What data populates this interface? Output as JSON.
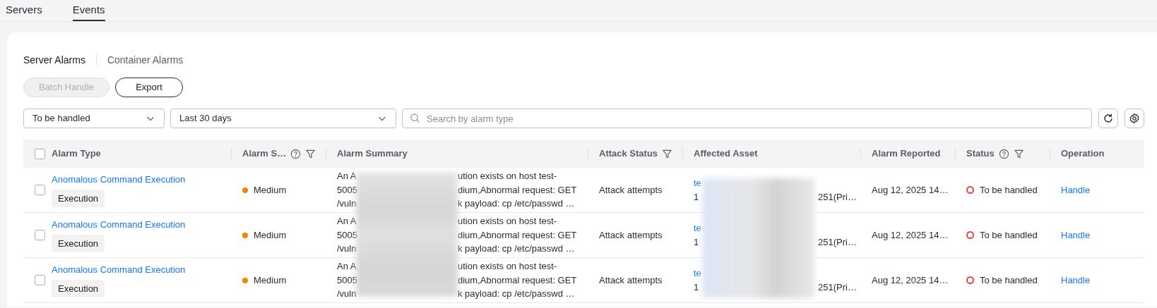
{
  "top_tabs": [
    {
      "label": "Servers",
      "selected": false
    },
    {
      "label": "Events",
      "selected": true
    }
  ],
  "alarm_tabs": [
    {
      "label": "Server Alarms",
      "selected": true
    },
    {
      "label": "Container Alarms",
      "selected": false
    }
  ],
  "actions": [
    {
      "label": "Batch Handle",
      "disabled": true
    },
    {
      "label": "Export",
      "disabled": false
    }
  ],
  "filters": {
    "status": "To be handled",
    "period": "Last 30 days",
    "search": {
      "placeholder": "Search by alarm type"
    }
  },
  "table": {
    "columns": [
      {
        "label": "Alarm Type",
        "help": false,
        "filter": false
      },
      {
        "label": "Alarm S…",
        "help": true,
        "filter": true
      },
      {
        "label": "Alarm Summary",
        "help": false,
        "filter": false
      },
      {
        "label": "Attack Status",
        "help": false,
        "filter": true
      },
      {
        "label": "Affected Asset",
        "help": false,
        "filter": false
      },
      {
        "label": "Alarm Reported",
        "help": false,
        "filter": false
      },
      {
        "label": "Status",
        "help": true,
        "filter": true
      },
      {
        "label": "Operation",
        "help": false,
        "filter": false
      }
    ],
    "all_selected": false,
    "rows": [
      {
        "selected": false,
        "alarm_type": "Anomalous Command Execution",
        "tag": "Execution",
        "severity": {
          "label": "Medium",
          "color": "#f5820b"
        },
        "summary": [
          {
            "before": "An A",
            "after": "ution exists on host test-"
          },
          {
            "before": "5005",
            "after": "dium,Abnormal request: GET"
          },
          {
            "before": "/vuln",
            "after": "k payload: cp /etc/passwd …"
          }
        ],
        "attack_status": "Attack attempts",
        "asset": [
          {
            "kind": "link",
            "before": "te"
          },
          {
            "kind": "text",
            "before": "1",
            "after": "251(Pri…"
          }
        ],
        "reported": "Aug 12, 2025 14…",
        "status": {
          "label": "To be handled",
          "color": "#e84545"
        },
        "operation": "Handle"
      },
      {
        "selected": false,
        "alarm_type": "Anomalous Command Execution",
        "tag": "Execution",
        "severity": {
          "label": "Medium",
          "color": "#f5820b"
        },
        "summary": [
          {
            "before": "An A",
            "after": "ution exists on host test-"
          },
          {
            "before": "5005",
            "after": "dium,Abnormal request: GET"
          },
          {
            "before": "/vuln",
            "after": "k payload: cp /etc/passwd …"
          }
        ],
        "attack_status": "Attack attempts",
        "asset": [
          {
            "kind": "link",
            "before": "te"
          },
          {
            "kind": "text",
            "before": "1",
            "after": "251(Pri…"
          }
        ],
        "reported": "Aug 12, 2025 14…",
        "status": {
          "label": "To be handled",
          "color": "#e84545"
        },
        "operation": "Handle"
      },
      {
        "selected": false,
        "alarm_type": "Anomalous Command Execution",
        "tag": "Execution",
        "severity": {
          "label": "Medium",
          "color": "#f5820b"
        },
        "summary": [
          {
            "before": "An A",
            "after": "ution exists on host test-"
          },
          {
            "before": "5005",
            "after": "dium,Abnormal request: GET"
          },
          {
            "before": "/vuln",
            "after": "k payload: cp /etc/passwd …"
          }
        ],
        "attack_status": "Attack attempts",
        "asset": [
          {
            "kind": "link",
            "before": "te"
          },
          {
            "kind": "text",
            "before": "1",
            "after": "251(Pri…"
          }
        ],
        "reported": "Aug 12, 2025 14…",
        "status": {
          "label": "To be handled",
          "color": "#e84545"
        },
        "operation": "Handle"
      }
    ]
  }
}
